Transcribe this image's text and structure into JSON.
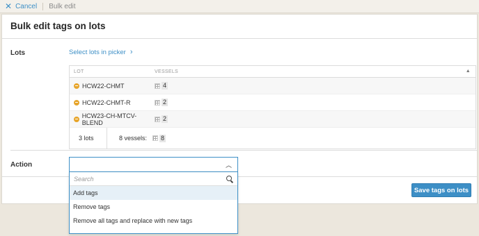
{
  "topbar": {
    "cancel_label": "Cancel",
    "breadcrumb": "Bulk edit"
  },
  "page": {
    "title": "Bulk edit tags on lots"
  },
  "lots": {
    "label": "Lots",
    "picker_link": "Select lots in picker",
    "columns": [
      "LOT",
      "VESSELS"
    ],
    "rows": [
      {
        "name": "HCW22-CHMT",
        "vessels": "4"
      },
      {
        "name": "HCW22-CHMT-R",
        "vessels": "2"
      },
      {
        "name": "HCW23-CH-MTCV-BLEND",
        "vessels": "2"
      }
    ],
    "summary": {
      "lots": "3 lots",
      "vessels_label": "8 vessels:",
      "vessels_count": "8"
    }
  },
  "action": {
    "label": "Action",
    "selected": "",
    "search_placeholder": "Search",
    "options": [
      "Add tags",
      "Remove tags",
      "Remove all tags and replace with new tags"
    ]
  },
  "footer": {
    "save_label": "Save tags on lots"
  },
  "icons": {
    "cancel": "close-icon",
    "picker": "chevron-right-icon",
    "sort": "sort-up-icon",
    "lot": "lot-icon",
    "vessel": "vessel-grid-icon",
    "select": "chevron-up-icon",
    "search": "search-icon"
  },
  "colors": {
    "accent": "#3d8fc6",
    "background": "#ece7dd",
    "lot_icon": "#e7a52b",
    "highlight": "#e6f0f7"
  }
}
